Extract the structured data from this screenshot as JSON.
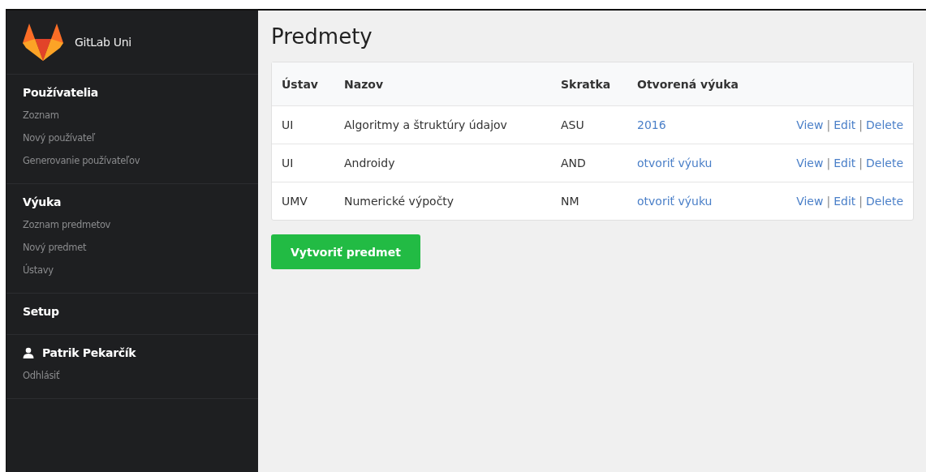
{
  "sidebar": {
    "brand": "GitLab Uni",
    "sections": [
      {
        "kind": "group",
        "title": "Používatelia",
        "items": [
          "Zoznam",
          "Nový používateľ",
          "Generovanie používateľov"
        ]
      },
      {
        "kind": "group",
        "title": "Výuka",
        "items": [
          "Zoznam predmetov",
          "Nový predmet",
          "Ústavy"
        ]
      },
      {
        "kind": "link",
        "title": "Setup"
      },
      {
        "kind": "user",
        "title": "Patrik Pekarčík",
        "items": [
          "Odhlásiť"
        ]
      }
    ]
  },
  "page": {
    "title": "Predmety",
    "table": {
      "columns": [
        "Ústav",
        "Nazov",
        "Skratka",
        "Otvorená výuka"
      ],
      "rows": [
        {
          "cells": [
            "UI",
            "Algoritmy a štruktúry údajov",
            "ASU",
            "2016"
          ],
          "actions": [
            {
              "kind": "link",
              "text": "View"
            },
            {
              "kind": "separator",
              "text": "|"
            },
            {
              "kind": "link",
              "text": "Edit"
            },
            {
              "kind": "separator",
              "text": "|"
            },
            {
              "kind": "link",
              "text": "Delete"
            }
          ]
        },
        {
          "cells": [
            "UI",
            "Androidy",
            "AND",
            "otvoriť výuku"
          ],
          "actions": [
            {
              "kind": "link",
              "text": "View"
            },
            {
              "kind": "separator",
              "text": "|"
            },
            {
              "kind": "link",
              "text": "Edit"
            },
            {
              "kind": "separator",
              "text": "|"
            },
            {
              "kind": "link",
              "text": "Delete"
            }
          ]
        },
        {
          "cells": [
            "UMV",
            "Numerické výpočty",
            "NM",
            "otvoriť výuku"
          ],
          "actions": [
            {
              "kind": "link",
              "text": "View"
            },
            {
              "kind": "separator",
              "text": "|"
            },
            {
              "kind": "link",
              "text": "Edit"
            },
            {
              "kind": "separator",
              "text": "|"
            },
            {
              "kind": "link",
              "text": "Delete"
            }
          ]
        }
      ]
    },
    "create_button": "Vytvoriť predmet"
  }
}
